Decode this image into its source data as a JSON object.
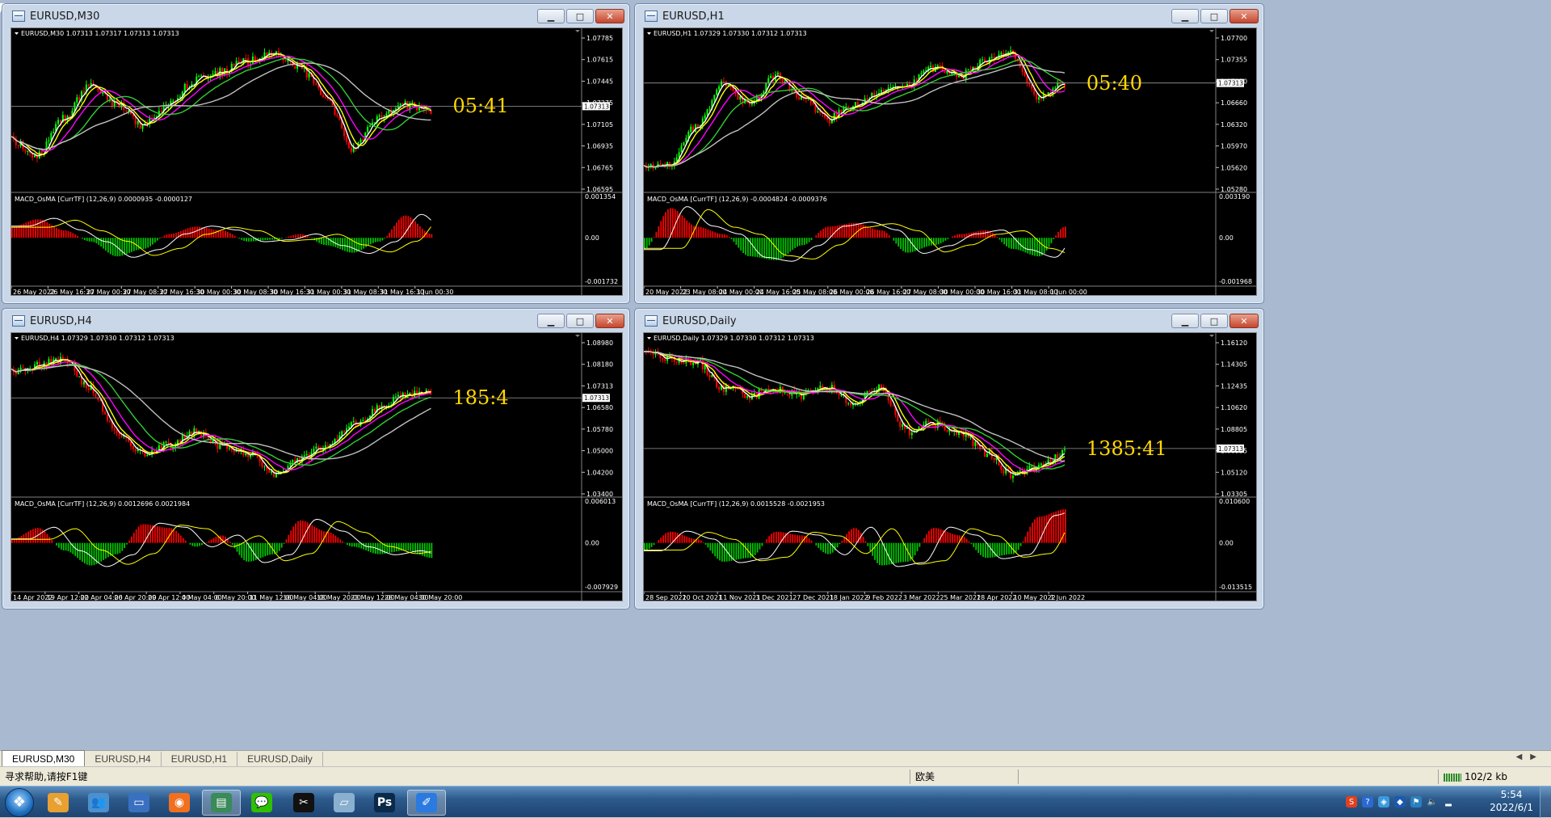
{
  "colors": {
    "bull": "#00ff00",
    "bear": "#ff0000",
    "ma_white": "#ffffff",
    "ma_yellow": "#ffff00",
    "ma_magenta": "#ff00ff",
    "ma_green": "#32cd32",
    "ma_gray": "#c0c0c0",
    "timer": "#ffd700",
    "osma_pos": "#ff0000",
    "osma_neg": "#00c800"
  },
  "windows": [
    {
      "id": "m30",
      "title": "EURUSD,M30",
      "ohlc": "EURUSD,M30  1.07313  1.07317  1.07313  1.07313",
      "price_ticks": [
        "1.07785",
        "1.07615",
        "1.07445",
        "1.07275",
        "1.07105",
        "1.06935",
        "1.06765",
        "1.06595"
      ],
      "current_price": "1.07313",
      "current_frac": 0.46,
      "macd_label": "MACD_OsMA [CurrTF] (12,26,9) 0.0000935 -0.0000127",
      "macd_ticks": [
        "0.001354",
        "0.00",
        "-0.001732"
      ],
      "time_ticks": [
        "26 May 2022",
        "26 May 16:30",
        "27 May 00:30",
        "27 May 08:30",
        "27 May 16:30",
        "30 May 00:30",
        "30 May 08:30",
        "30 May 16:30",
        "31 May 00:30",
        "31 May 08:30",
        "31 May 16:30",
        "1 Jun 00:30"
      ],
      "timer": "05:41",
      "shape": [
        0.7,
        0.8,
        0.55,
        0.3,
        0.45,
        0.6,
        0.45,
        0.28,
        0.22,
        0.15,
        0.1,
        0.2,
        0.4,
        0.75,
        0.55,
        0.45,
        0.5
      ],
      "osma": [
        0.3,
        0.5,
        0.2,
        -0.1,
        -0.5,
        -0.3,
        0.1,
        0.3,
        0.2,
        -0.1,
        -0.05,
        0.1,
        -0.2,
        -0.4,
        -0.1,
        0.6,
        0.1
      ]
    },
    {
      "id": "h1",
      "title": "EURUSD,H1",
      "ohlc": "EURUSD,H1  1.07329  1.07330  1.07312  1.07313",
      "price_ticks": [
        "1.07700",
        "1.07355",
        "1.07010",
        "1.06660",
        "1.06320",
        "1.05970",
        "1.05620",
        "1.05280"
      ],
      "current_price": "1.07313",
      "current_frac": 0.3,
      "macd_label": "MACD_OsMA [CurrTF] (12,26,9) -0.0004824 -0.0009376",
      "macd_ticks": [
        "0.003190",
        "0.00",
        "-0.001968"
      ],
      "time_ticks": [
        "20 May 2022",
        "23 May 08:00",
        "24 May 00:00",
        "24 May 16:00",
        "25 May 08:00",
        "26 May 00:00",
        "26 May 16:00",
        "27 May 08:00",
        "30 May 00:00",
        "30 May 16:00",
        "31 May 08:00",
        "1 Jun 00:00"
      ],
      "timer": "05:40",
      "shape": [
        0.9,
        0.85,
        0.6,
        0.3,
        0.45,
        0.25,
        0.4,
        0.55,
        0.45,
        0.35,
        0.3,
        0.2,
        0.25,
        0.15,
        0.1,
        0.4,
        0.3
      ],
      "osma": [
        -0.3,
        0.8,
        0.3,
        0.1,
        -0.5,
        -0.6,
        -0.2,
        0.3,
        0.4,
        0.2,
        -0.4,
        -0.2,
        0.1,
        0.2,
        -0.3,
        -0.5,
        0.3
      ]
    },
    {
      "id": "h4",
      "title": "EURUSD,H4",
      "ohlc": "EURUSD,H4  1.07329  1.07330  1.07312  1.07313",
      "price_ticks": [
        "1.08980",
        "1.08180",
        "1.07313",
        "1.06580",
        "1.05780",
        "1.05000",
        "1.04200",
        "1.03400"
      ],
      "current_price": "1.07313",
      "current_frac": 0.37,
      "macd_label": "MACD_OsMA [CurrTF] (12,26,9) 0.0012696 0.0021984",
      "macd_ticks": [
        "0.006013",
        "0.00",
        "-0.007929"
      ],
      "time_ticks": [
        "14 Apr 2022",
        "19 Apr 12:00",
        "22 Apr 04:00",
        "26 Apr 20:00",
        "29 Apr 12:00",
        "4 May 04:00",
        "6 May 20:00",
        "11 May 12:00",
        "16 May 04:00",
        "18 May 20:00",
        "23 May 12:00",
        "26 May 04:00",
        "30 May 20:00"
      ],
      "timer": "185:4",
      "shape": [
        0.2,
        0.15,
        0.1,
        0.3,
        0.6,
        0.75,
        0.7,
        0.6,
        0.7,
        0.75,
        0.9,
        0.8,
        0.7,
        0.55,
        0.45,
        0.35,
        0.3
      ],
      "osma": [
        0.1,
        0.4,
        -0.2,
        -0.6,
        -0.3,
        0.5,
        0.4,
        -0.1,
        0.2,
        -0.5,
        -0.3,
        0.6,
        0.3,
        -0.1,
        -0.3,
        -0.2,
        -0.4
      ]
    },
    {
      "id": "d1",
      "title": "EURUSD,Daily",
      "ohlc": "EURUSD,Daily  1.07329  1.07330  1.07312  1.07313",
      "price_ticks": [
        "1.16120",
        "1.14305",
        "1.12435",
        "1.10620",
        "1.08805",
        "1.06935",
        "1.05120",
        "1.03305"
      ],
      "current_price": "1.07313",
      "current_frac": 0.72,
      "macd_label": "MACD_OsMA [CurrTF] (12,26,9) 0.0015528 -0.0021953",
      "macd_ticks": [
        "0.010600",
        "0.00",
        "-0.013515"
      ],
      "time_ticks": [
        "28 Sep 2021",
        "20 Oct 2021",
        "11 Nov 2021",
        "3 Dec 2021",
        "27 Dec 2021",
        "18 Jan 2022",
        "9 Feb 2022",
        "3 Mar 2022",
        "25 Mar 2022",
        "18 Apr 2022",
        "10 May 2022",
        "1 Jun 2022"
      ],
      "timer": "1385:41",
      "shape": [
        0.05,
        0.1,
        0.12,
        0.3,
        0.35,
        0.32,
        0.35,
        0.3,
        0.4,
        0.3,
        0.6,
        0.55,
        0.6,
        0.75,
        0.9,
        0.85,
        0.75
      ],
      "osma": [
        -0.2,
        0.3,
        0.1,
        -0.5,
        -0.4,
        0.3,
        0.2,
        -0.3,
        0.4,
        -0.6,
        -0.5,
        0.4,
        0.2,
        -0.4,
        -0.3,
        0.7,
        0.9
      ]
    }
  ],
  "tabs": [
    "EURUSD,M30",
    "EURUSD,H4",
    "EURUSD,H1",
    "EURUSD,Daily"
  ],
  "active_tab": 0,
  "status": {
    "help": "寻求帮助,请按F1键",
    "profile": "欧美",
    "traffic": "102/2 kb"
  },
  "taskbar": {
    "apps": [
      {
        "name": "paint",
        "glyph": "✎",
        "color": "#e8a030"
      },
      {
        "name": "contacts",
        "glyph": "👥",
        "color": "#4a90d0"
      },
      {
        "name": "desktop",
        "glyph": "▭",
        "color": "#3a70c0"
      },
      {
        "name": "media",
        "glyph": "◉",
        "color": "#f07020"
      },
      {
        "name": "metatrader",
        "glyph": "▤",
        "color": "#3a8a5a"
      },
      {
        "name": "wechat",
        "glyph": "💬",
        "color": "#2dc100"
      },
      {
        "name": "capcut",
        "glyph": "✂",
        "color": "#111111"
      },
      {
        "name": "notes",
        "glyph": "▱",
        "color": "#8ab0d0"
      },
      {
        "name": "photoshop",
        "glyph": "Ps",
        "color": "#0a2a4a"
      },
      {
        "name": "pen-app",
        "glyph": "✐",
        "color": "#2a7ae0"
      }
    ],
    "time": "5:54",
    "date": "2022/6/1"
  }
}
